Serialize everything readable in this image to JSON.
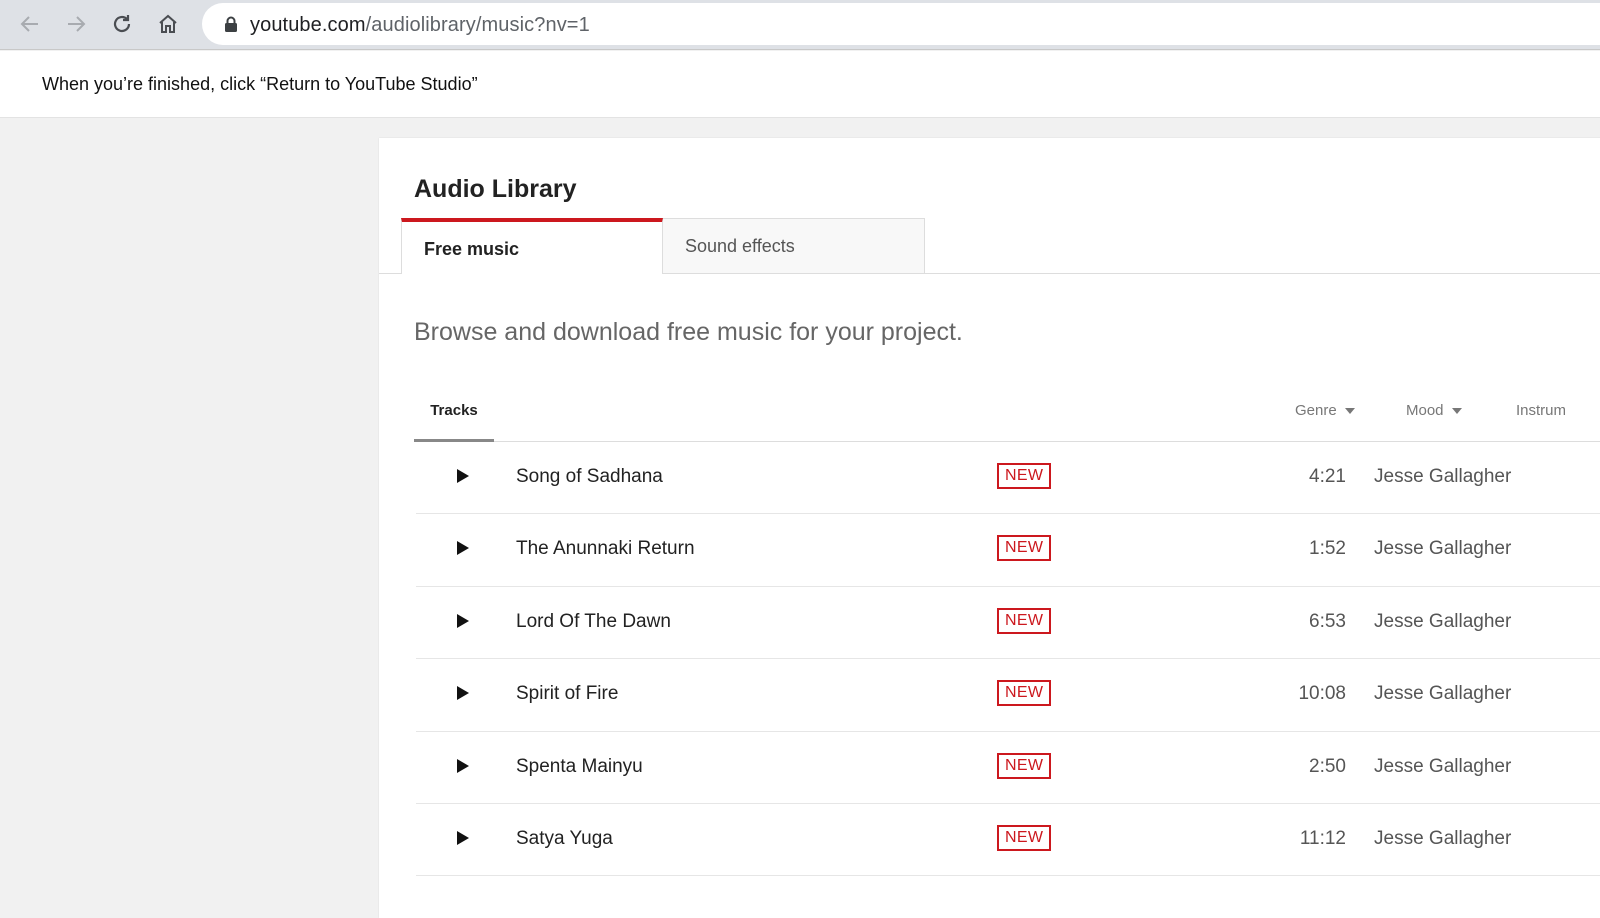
{
  "browser": {
    "url_host": "youtube.com",
    "url_path": "/audiolibrary/music?nv=1",
    "icons": [
      "back-arrow-icon",
      "forward-arrow-icon",
      "reload-icon",
      "home-icon",
      "lock-icon"
    ]
  },
  "instruction": "When you’re finished, click “Return to YouTube Studio”",
  "page": {
    "title": "Audio Library",
    "tabs": [
      {
        "label": "Free music",
        "active": true
      },
      {
        "label": "Sound effects",
        "active": false
      }
    ],
    "subtitle": "Browse and download free music for your project.",
    "sub_tab": "Tracks",
    "filters": [
      "Genre",
      "Mood",
      "Instrum"
    ]
  },
  "tracks": [
    {
      "title": "Song of Sadhana",
      "badge": "NEW",
      "duration": "4:21",
      "artist": "Jesse Gallagher"
    },
    {
      "title": "The Anunnaki Return",
      "badge": "NEW",
      "duration": "1:52",
      "artist": "Jesse Gallagher"
    },
    {
      "title": "Lord Of The Dawn",
      "badge": "NEW",
      "duration": "6:53",
      "artist": "Jesse Gallagher"
    },
    {
      "title": "Spirit of Fire",
      "badge": "NEW",
      "duration": "10:08",
      "artist": "Jesse Gallagher"
    },
    {
      "title": "Spenta Mainyu",
      "badge": "NEW",
      "duration": "2:50",
      "artist": "Jesse Gallagher"
    },
    {
      "title": "Satya Yuga",
      "badge": "NEW",
      "duration": "11:12",
      "artist": "Jesse Gallagher"
    }
  ],
  "colors": {
    "accent_red": "#cc181e",
    "page_bg": "#f1f1f1",
    "chrome_bg": "#dee1e6"
  }
}
